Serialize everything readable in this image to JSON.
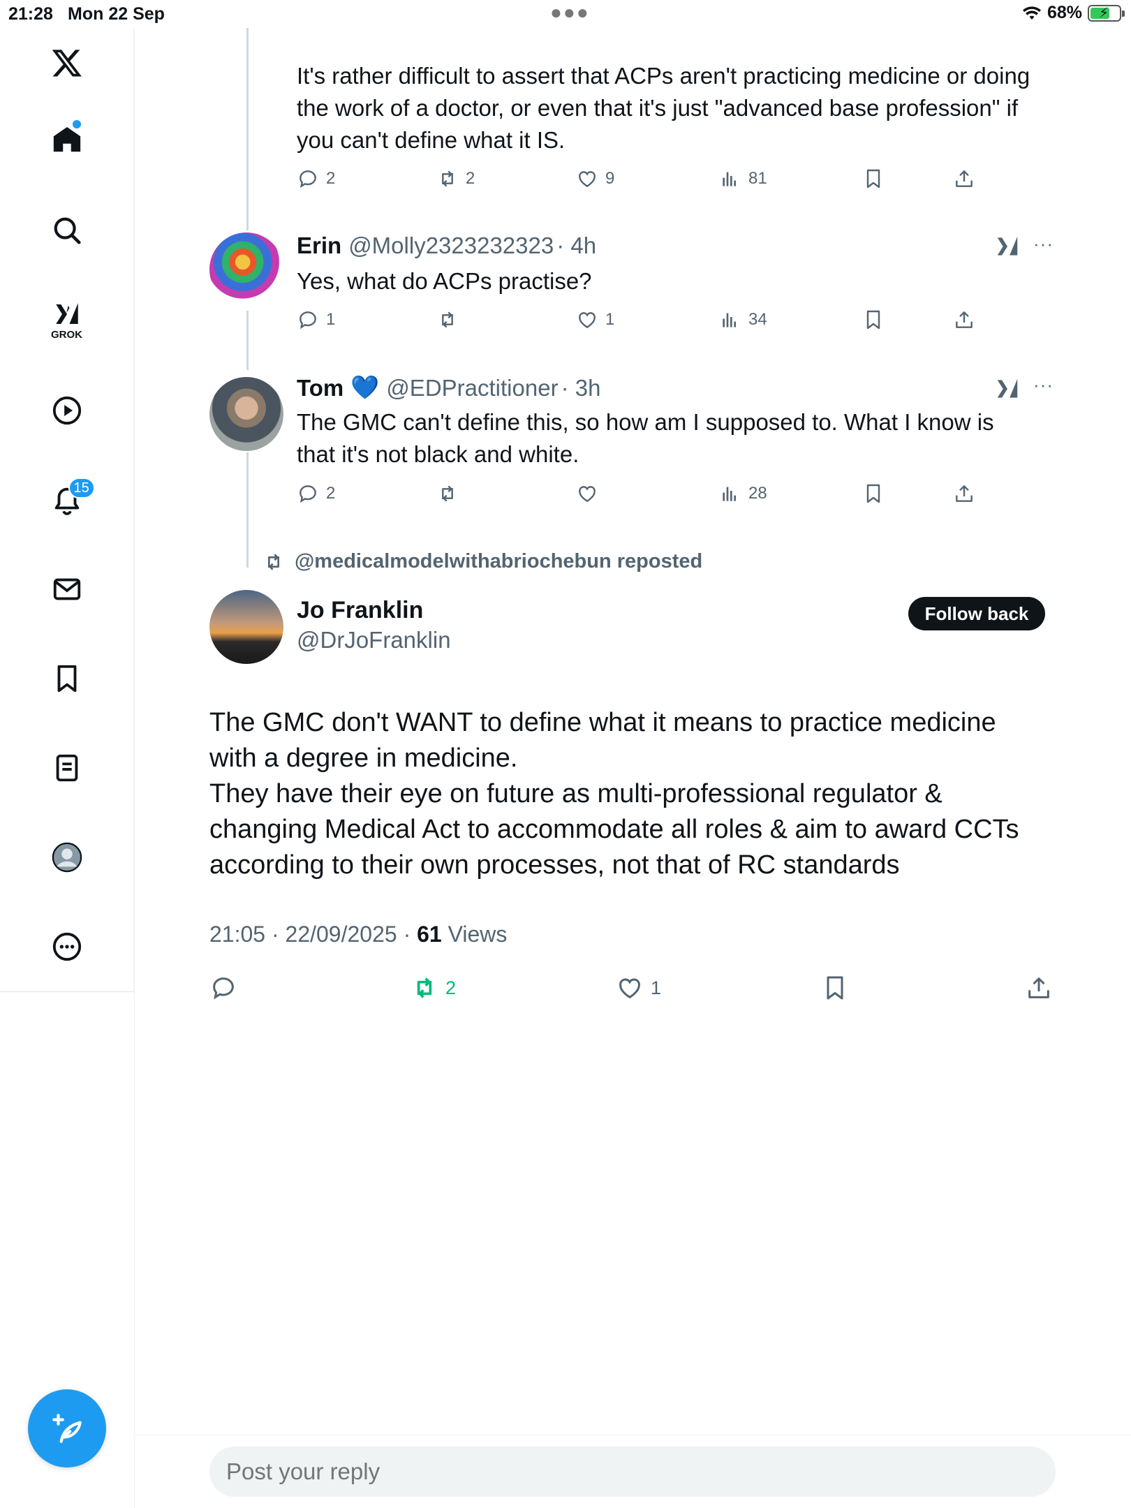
{
  "status_bar": {
    "time": "21:28",
    "date": "Mon 22 Sep",
    "battery": "68%"
  },
  "sidebar": {
    "grok_label": "GROK",
    "notifications_badge": "15"
  },
  "thread": {
    "first_post": {
      "text": "It's rather difficult to assert that ACPs aren't practicing medicine or doing the work of a doctor, or even that it's just \"advanced base profession\" if you can't define what it IS.",
      "replies": "2",
      "reposts": "2",
      "likes": "9",
      "views": "81"
    },
    "posts": [
      {
        "name": "Erin",
        "handle": "@Molly2323232323",
        "time": "· 4h",
        "text": "Yes, what do ACPs practise?",
        "replies": "1",
        "reposts": "",
        "likes": "1",
        "views": "34"
      },
      {
        "name": "Tom",
        "emoji": "💙",
        "handle": "@EDPractitioner",
        "time": "· 3h",
        "text": "The GMC can't define this, so how am I supposed to. What I know is that it's not black and white.",
        "replies": "2",
        "reposts": "",
        "likes": "",
        "views": "28"
      }
    ],
    "more_label": "···"
  },
  "main_post": {
    "repost_label": "@medicalmodelwithabriochebun reposted",
    "name": "Jo Franklin",
    "handle": "@DrJoFranklin",
    "follow_label": "Follow back",
    "text_lines": [
      "The GMC don't WANT to define what it means to practice medicine with a degree in medicine.",
      "They have their eye on future as multi-professional regulator & changing Medical Act to accommodate all roles & aim to award CCTs according to their own processes, not that of RC standards"
    ],
    "timestamp": "21:05 · 22/09/2025 · ",
    "views_count": "61",
    "views_label": " Views",
    "reposts": "2",
    "likes": "1",
    "repost_color": "#00ba7c"
  },
  "reply": {
    "placeholder": "Post your reply"
  },
  "colors": {
    "accent": "#1d9bf0",
    "muted": "#536471",
    "text": "#0f1419"
  }
}
